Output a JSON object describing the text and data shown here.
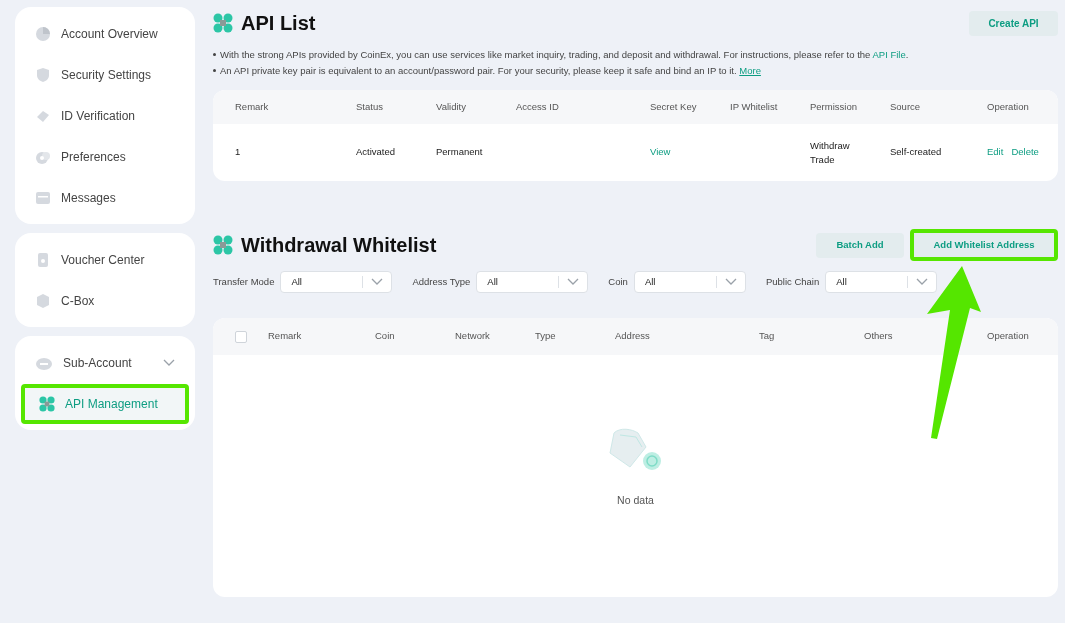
{
  "sidebar": {
    "groups": [
      {
        "items": [
          {
            "label": "Account Overview",
            "selected": false,
            "highlighted": false
          },
          {
            "label": "Security Settings",
            "selected": false,
            "highlighted": false
          },
          {
            "label": "ID Verification",
            "selected": false,
            "highlighted": false
          },
          {
            "label": "Preferences",
            "selected": false,
            "highlighted": false
          },
          {
            "label": "Messages",
            "selected": false,
            "highlighted": false
          }
        ]
      },
      {
        "items": [
          {
            "label": "Voucher Center",
            "selected": false,
            "highlighted": false
          },
          {
            "label": "C-Box",
            "selected": false,
            "highlighted": false
          }
        ]
      },
      {
        "items": [
          {
            "label": "Sub-Account",
            "selected": false,
            "highlighted": false,
            "expandable": true
          },
          {
            "label": "API Management",
            "selected": true,
            "highlighted": true
          }
        ]
      }
    ]
  },
  "api_list": {
    "title": "API List",
    "create_button": "Create API",
    "notes": [
      {
        "text": "With the strong APIs provided by CoinEx, you can use services like market inquiry, trading, and deposit and withdrawal. For instructions, please refer to the ",
        "link": "API File",
        "link_underlined": false,
        "suffix": "."
      },
      {
        "text": "An API private key pair is equivalent to an account/password pair. For your security, please keep it safe and bind an IP to it. ",
        "link": "More",
        "link_underlined": true
      }
    ],
    "columns": [
      "Remark",
      "Status",
      "Validity",
      "Access ID",
      "Secret Key",
      "IP Whitelist",
      "Permission",
      "Source",
      "Operation"
    ],
    "rows": [
      {
        "remark": "1",
        "status": "Activated",
        "validity": "Permanent",
        "secret_key": "View",
        "permission": [
          "Withdraw",
          "Trade"
        ],
        "source": "Self-created",
        "operations": [
          "Edit",
          "Delete"
        ]
      }
    ]
  },
  "whitelist": {
    "title": "Withdrawal Whitelist",
    "buttons": [
      {
        "label": "Batch Add",
        "highlighted": false
      },
      {
        "label": "Add Whitelist Address",
        "highlighted": true
      }
    ],
    "pointer_arrow": true,
    "filters": [
      {
        "label": "Transfer Mode",
        "value": "All"
      },
      {
        "label": "Address Type",
        "value": "All"
      },
      {
        "label": "Coin",
        "value": "All"
      },
      {
        "label": "Public Chain",
        "value": "All"
      }
    ],
    "select_all_checked": false,
    "columns": [
      "Remark",
      "Coin",
      "Network",
      "Type",
      "Address",
      "Tag",
      "Others",
      "Operation"
    ],
    "empty_text": "No data"
  }
}
